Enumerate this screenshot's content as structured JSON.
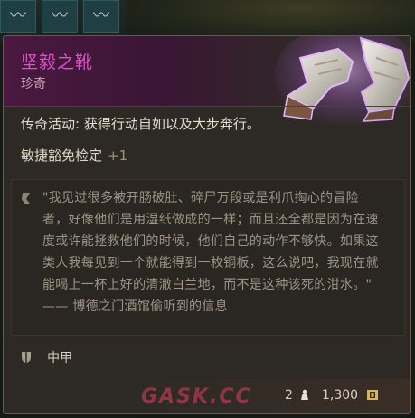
{
  "item": {
    "name": "坚毅之靴",
    "rarity": "珍奇",
    "passive_label": "传奇活动: ",
    "passive_text": "获得行动自如以及大步奔行。",
    "bonus_label": "敏捷豁免检定",
    "bonus_value": "+1",
    "lore": "\"我见过很多被开肠破肚、碎尸万段或是利爪掏心的冒险者，好像他们是用湿纸做成的一样；而且还全都是因为在速度或许能拯救他们的时候，他们自己的动作不够快。如果这类人我每见到一个就能得到一枚铜板，这么说吧，我现在就能喝上一杯上好的清澈白兰地，而不是这种该死的泔水。\" —— 博德之门酒馆偷听到的信息",
    "armor_type": "中甲",
    "weight": "2",
    "price": "1,300"
  },
  "watermark": "GASK.CC",
  "icons": {
    "item": "boots-image",
    "quote": "quote-mark-icon",
    "armor": "shield-icon",
    "weight": "weight-icon",
    "price": "gold-coin-icon"
  },
  "colors": {
    "item_name": "#e050c8",
    "header_tint": "#4a1840",
    "tooltip_bg": "#2d2a26",
    "lore_text": "#9d9485"
  }
}
